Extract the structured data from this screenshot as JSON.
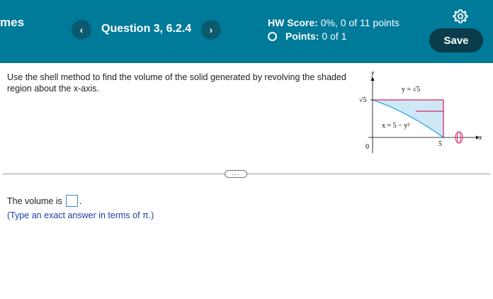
{
  "header": {
    "app_title": "mes",
    "prev_label": "‹",
    "next_label": "›",
    "question": "Question 3, 6.2.4",
    "hw_score_label": "HW Score:",
    "hw_score_value": "0%, 0 of 11 points",
    "points_label": "Points:",
    "points_value": "0 of 1",
    "save_label": "Save",
    "settings_icon": "gear-icon"
  },
  "question": {
    "prompt": "Use the shell method to find the volume of the solid generated by revolving the shaded region about the x-axis."
  },
  "figure": {
    "y_axis_label": "y",
    "x_axis_label": "x",
    "origin_label": "0",
    "y_tick": "√5",
    "x_tick": "5",
    "upper_curve_label": "y = √5",
    "lower_curve_label": "x = 5 − y²",
    "colors": {
      "shade": "#cfe8f6",
      "curve": "#2aa7dd",
      "boundary": "#d6226e",
      "axis": "#000000"
    }
  },
  "more_label": "···",
  "answer": {
    "prefix": "The volume is",
    "suffix": ".",
    "hint": "(Type an exact answer in terms of π.)"
  }
}
